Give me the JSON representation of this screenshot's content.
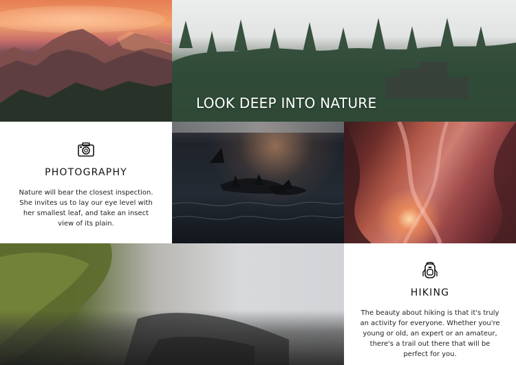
{
  "hero": {
    "title": "LOOK DEEP INTO NATURE"
  },
  "cards": {
    "photography": {
      "icon": "camera-icon",
      "title": "PHOTOGRAPHY",
      "text": "Nature will bear the closest inspection. She invites us to lay our eye level with her smallest leaf, and take an insect view of its plain."
    },
    "hiking": {
      "icon": "backpack-icon",
      "title": "HIKING",
      "text": "The beauty about hiking is that it's truly an activity for everyone. Whether you're young or old, an expert or an amateur, there's a trail out there that will be perfect for you."
    }
  },
  "images": {
    "mountains": "mountain-photo",
    "jungle": "jungle-photo",
    "orcas": "orcas-photo",
    "canyon": "canyon-photo",
    "coast": "coast-photo"
  },
  "colors": {
    "card_bg": "#ffffff",
    "text_dark": "#111111",
    "hero_text": "#ffffff"
  }
}
